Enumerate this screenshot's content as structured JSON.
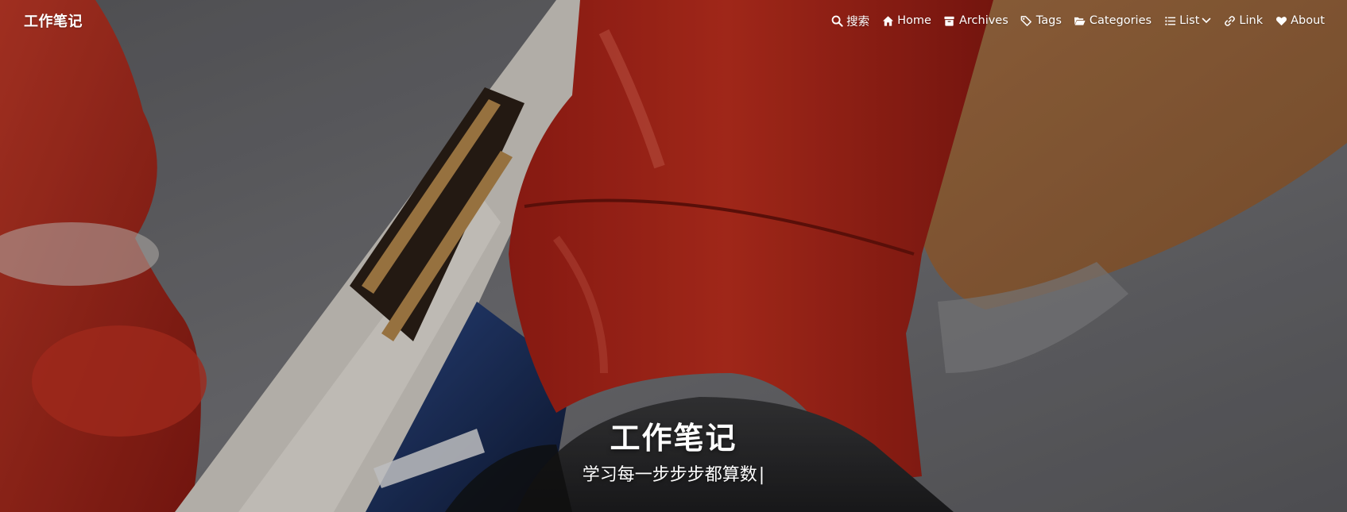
{
  "navbar": {
    "brand": "工作笔记",
    "items": [
      {
        "label": "搜索",
        "icon": "search-icon"
      },
      {
        "label": "Home",
        "icon": "home-icon"
      },
      {
        "label": "Archives",
        "icon": "archive-icon"
      },
      {
        "label": "Tags",
        "icon": "tags-icon"
      },
      {
        "label": "Categories",
        "icon": "folder-open-icon"
      },
      {
        "label": "List",
        "icon": "list-icon"
      },
      {
        "label": "Link",
        "icon": "link-icon"
      },
      {
        "label": "About",
        "icon": "heart-icon"
      }
    ]
  },
  "hero": {
    "title": "工作笔记",
    "subtitle": "学习每一步步步都算数",
    "cursor": "|"
  },
  "colors": {
    "frame_red": "#b8281c",
    "background_gray": "#6b6b6e",
    "text": "#ffffff"
  }
}
